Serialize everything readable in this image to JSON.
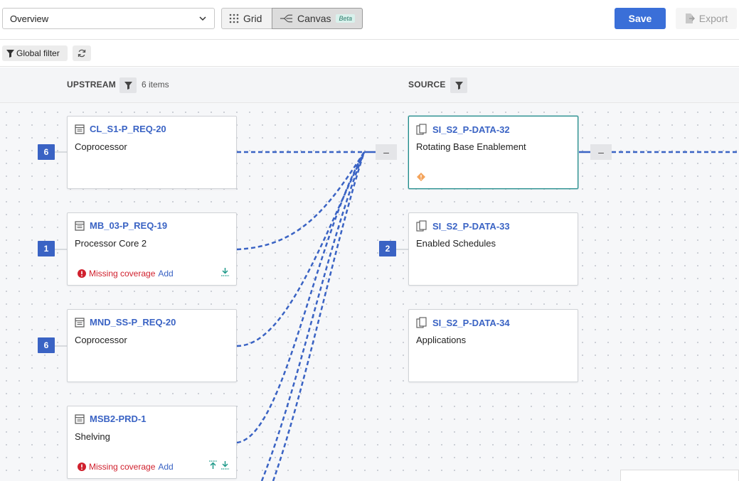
{
  "toolbar": {
    "view_select": "Overview",
    "grid_label": "Grid",
    "canvas_label": "Canvas",
    "beta_label": "Beta",
    "save_label": "Save",
    "export_label": "Export"
  },
  "filterbar": {
    "global_filter_label": "Global filter"
  },
  "columns": {
    "upstream_title": "UPSTREAM",
    "upstream_count": "6 items",
    "source_title": "SOURCE"
  },
  "upstream_cards": [
    {
      "id": "CL_S1-P_REQ-20",
      "subtitle": "Coprocessor",
      "badge": "6"
    },
    {
      "id": "MB_03-P_REQ-19",
      "subtitle": "Processor Core 2",
      "badge": "1",
      "warning": "Missing coverage",
      "action": "Add"
    },
    {
      "id": "MND_SS-P_REQ-20",
      "subtitle": "Coprocessor",
      "badge": "6"
    },
    {
      "id": "MSB2-PRD-1",
      "subtitle": "Shelving",
      "warning": "Missing coverage",
      "action": "Add"
    }
  ],
  "source_cards": [
    {
      "id": "SI_S2_P-DATA-32",
      "subtitle": "Rotating Base Enablement"
    },
    {
      "id": "SI_S2_P-DATA-33",
      "subtitle": "Enabled Schedules",
      "badge": "2"
    },
    {
      "id": "SI_S2_P-DATA-34",
      "subtitle": "Applications"
    }
  ],
  "colors": {
    "accent": "#3a63c4",
    "save": "#3a6fd8",
    "warning": "#d0202d",
    "selected_border": "#1f8a8a",
    "link_line": "#3a63c4"
  },
  "icons": {
    "requirement": "requirement-icon",
    "data": "data-copy-icon",
    "filter": "filter-icon",
    "refresh": "refresh-icon",
    "grid": "grid-icon",
    "canvas": "canvas-icon",
    "export": "export-icon",
    "error": "error-icon",
    "download": "download-icon",
    "upload": "upload-icon",
    "diamond": "diamond-warning-icon"
  }
}
